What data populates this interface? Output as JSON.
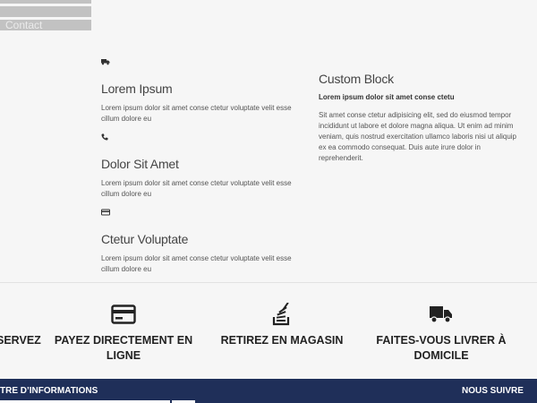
{
  "top": {
    "ghost_label": "Contact"
  },
  "items": [
    {
      "icon": "truck-icon",
      "title": "Lorem Ipsum",
      "text": "Lorem ipsum dolor sit amet conse ctetur voluptate velit esse cillum dolore eu"
    },
    {
      "icon": "phone-icon",
      "title": "Dolor Sit Amet",
      "text": "Lorem ipsum dolor sit amet conse ctetur voluptate velit esse cillum dolore eu"
    },
    {
      "icon": "credit-card-icon",
      "title": "Ctetur Voluptate",
      "text": "Lorem ipsum dolor sit amet conse ctetur voluptate velit esse cillum dolore eu"
    }
  ],
  "custom_block": {
    "title": "Custom Block",
    "subtitle": "Lorem ipsum dolor sit amet conse ctetu",
    "text": "Sit amet conse ctetur adipisicing elit, sed do eiusmod tempor incididunt ut labore et dolore magna aliqua. Ut enim ad minim veniam, quis nostrud exercitation ullamco laboris nisi ut aliquip ex ea commodo consequat. Duis aute irure dolor in reprehenderit."
  },
  "features": [
    {
      "label": "SERVEZ",
      "icon": ""
    },
    {
      "label": "PAYEZ DIRECTEMENT EN LIGNE",
      "icon": "credit-card-icon"
    },
    {
      "label": "RETIREZ EN MAGASIN",
      "icon": "stack-icon"
    },
    {
      "label": "FAITES-VOUS LIVRER À DOMICILE",
      "icon": "truck-icon"
    }
  ],
  "footer": {
    "left_label": "TRE D’INFORMATIONS",
    "right_label": "NOUS SUIVRE"
  },
  "colors": {
    "background": "#f6f6f6",
    "footer_bg": "#1f2f59",
    "bar_grey": "#c2c2c2"
  }
}
